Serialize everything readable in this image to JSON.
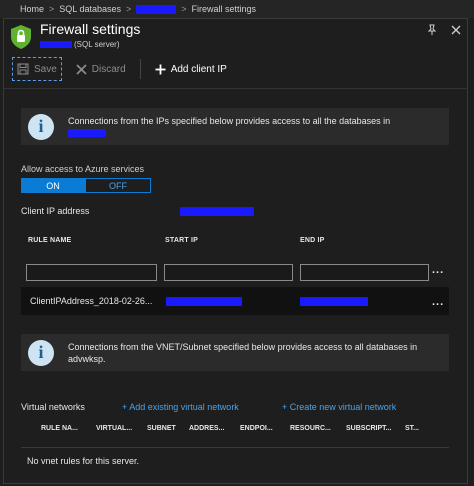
{
  "breadcrumb": {
    "home": "Home",
    "sql_databases": "SQL databases",
    "current": "Firewall settings",
    "sep": ">"
  },
  "header": {
    "title": "Firewall settings",
    "subtitle": "(SQL server)",
    "pin_icon": "pin-icon",
    "close_icon": "close-icon"
  },
  "toolbar": {
    "save_label": "Save",
    "discard_label": "Discard",
    "add_client_ip_label": "Add client IP"
  },
  "info_ip": {
    "text": "Connections from the IPs specified below provides access to all the databases in"
  },
  "azure_access": {
    "label": "Allow access to Azure services",
    "on_label": "ON",
    "off_label": "OFF",
    "selected": "ON"
  },
  "client_ip": {
    "label": "Client IP address"
  },
  "rules_table": {
    "columns": [
      "RULE NAME",
      "START IP",
      "END IP"
    ],
    "more": "...",
    "rows": [
      {
        "rule_name": "ClientIPAddress_2018-02-26...",
        "more": "..."
      }
    ]
  },
  "info_vnet": {
    "text": "Connections from the VNET/Subnet specified below provides access to all databases in advwksp."
  },
  "vnet": {
    "label": "Virtual networks",
    "add_existing_label": "+ Add existing virtual network",
    "create_new_label": "+ Create new virtual network",
    "columns": [
      "RULE NA...",
      "VIRTUAL...",
      "SUBNET",
      "ADDRES...",
      "ENDPOI...",
      "RESOURC...",
      "SUBSCRIPT...",
      "ST..."
    ],
    "empty_text": "No vnet rules for this server."
  },
  "colors": {
    "accent": "#0b7cd6",
    "link": "#4aa3ea",
    "background": "#1e1e1e",
    "shield": "#5fb32e"
  }
}
